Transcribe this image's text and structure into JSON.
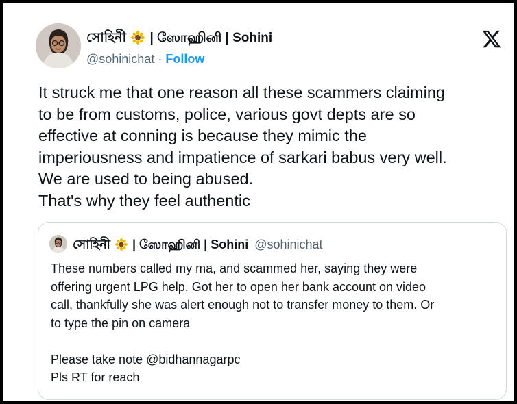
{
  "author": {
    "name_bengali": "সোহিনী",
    "name_rest": "| ஸோஹினி | Sohini",
    "flower_icon": "sunflower-icon",
    "handle": "@sohinichat",
    "separator": "·",
    "follow_label": "Follow"
  },
  "logo": "x-logo-icon",
  "tweet": {
    "lines": [
      "It struck me that one reason all these scammers claiming",
      "to be from customs, police, various govt depts are so",
      "effective at conning is because they mimic the",
      "imperiousness and impatience of sarkari babus very well.",
      "We are used to being abused.",
      "That's why they feel authentic"
    ]
  },
  "quoted": {
    "name_bengali": "সোহিনী",
    "name_rest": "| ஸோஹினி | Sohini",
    "handle": "@sohinichat",
    "lines": [
      "These numbers called my ma, and scammed her, saying they were",
      "offering urgent LPG help. Got her to open her bank account on video",
      "call, thankfully she was alert enough not to transfer money to them. Or",
      "to type the pin on camera",
      "",
      "Please take note @bidhannagarpc",
      "Pls RT for reach"
    ]
  },
  "colors": {
    "text": "#0f1419",
    "secondary": "#536471",
    "accent": "#1d9bf0",
    "border": "#cfd9de"
  }
}
